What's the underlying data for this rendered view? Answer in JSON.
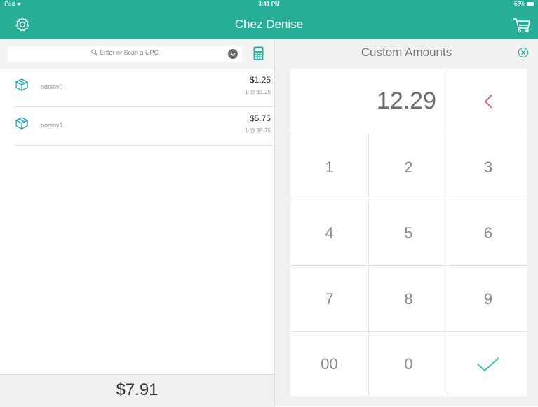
{
  "status_bar": {
    "device": "iPad",
    "time": "3:41 PM",
    "battery": "63%"
  },
  "header": {
    "title": "Chez Denise",
    "left_icon": "gear-icon",
    "right_icon": "cart-icon"
  },
  "search": {
    "placeholder": "Enter or Scan a UPC"
  },
  "items": [
    {
      "name": "noninv0",
      "price": "$1.25",
      "detail": "1 @ $1.25"
    },
    {
      "name": "noninv1",
      "price": "$5.75",
      "detail": "1 @ $5.75"
    }
  ],
  "total": "$7.91",
  "custom_amounts": {
    "title": "Custom Amounts",
    "amount": "12.29",
    "keys": [
      "1",
      "2",
      "3",
      "4",
      "5",
      "6",
      "7",
      "8",
      "9",
      "00",
      "0"
    ]
  },
  "colors": {
    "header": "#27ae97",
    "backspace": "#e15a5a",
    "confirm": "#3cc5b1",
    "icon_blue": "#1aa0c6"
  }
}
